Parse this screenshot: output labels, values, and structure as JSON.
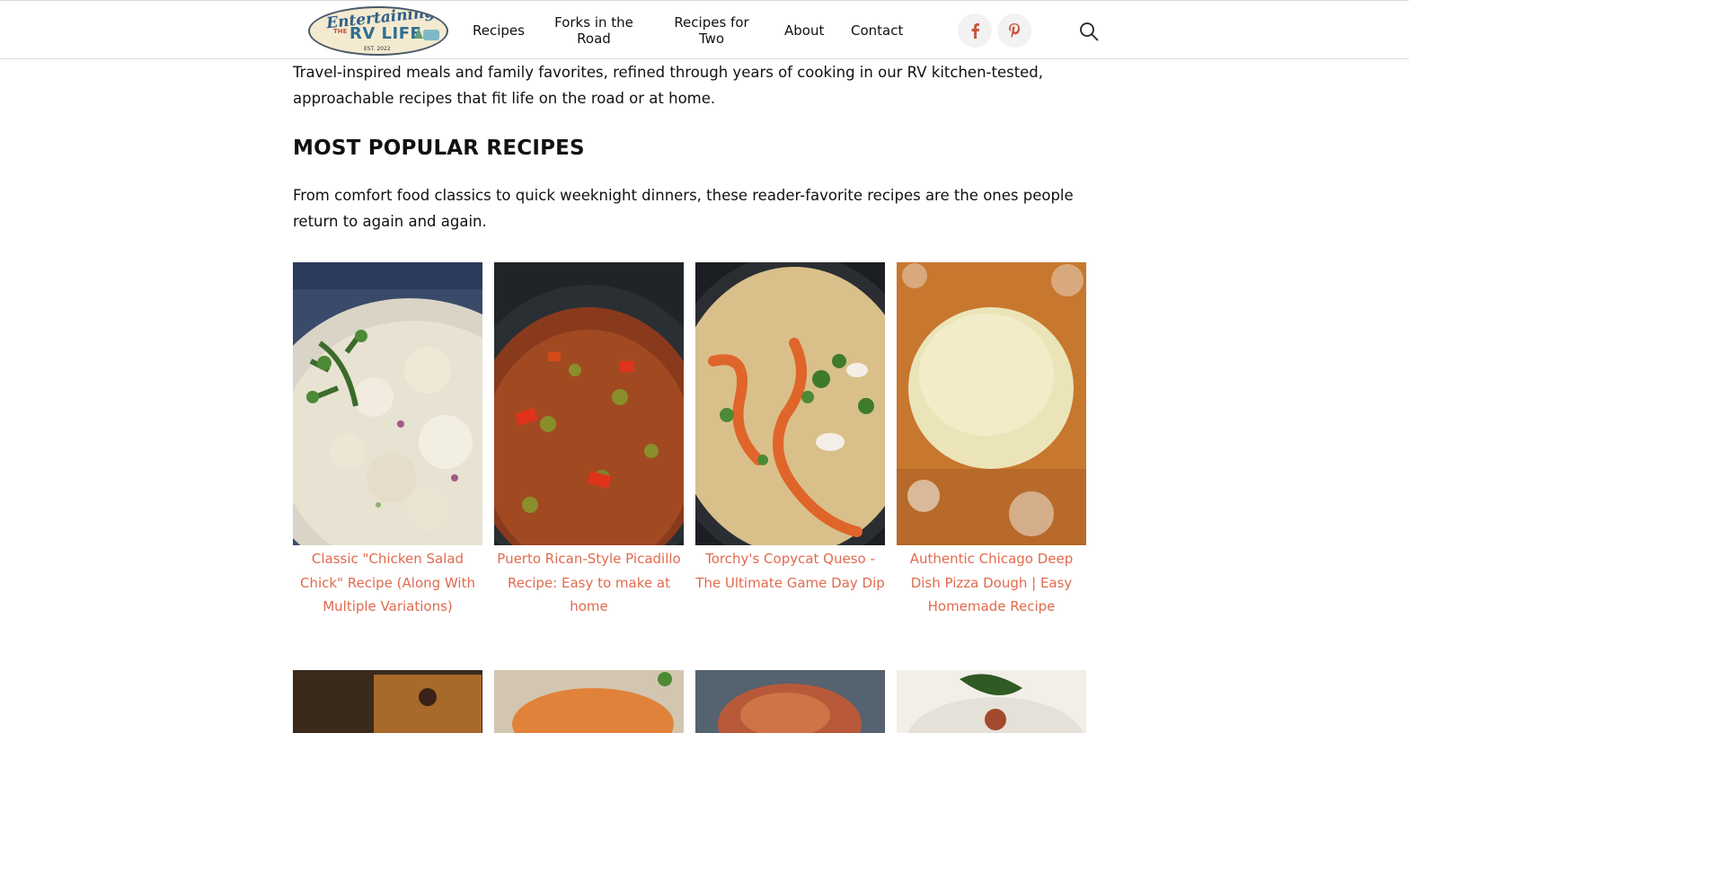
{
  "header": {
    "logo": {
      "line1": "Entertaining",
      "line2": "THE",
      "line3": "RV LIFE",
      "line4": "EST. 2022"
    },
    "nav": [
      "Recipes",
      "Forks in the Road",
      "Recipes for Two",
      "About",
      "Contact"
    ],
    "nav_lines": {
      "forks": [
        "Forks in the",
        "Road"
      ],
      "two": [
        "Recipes for",
        "Two"
      ]
    },
    "social": [
      "facebook-icon",
      "pinterest-icon"
    ],
    "search_icon": "search-icon"
  },
  "intro": "Travel-inspired meals and family favorites, refined through years of cooking in our RV kitchen-tested, approachable recipes that fit life on the road or at home.",
  "section": {
    "title": "MOST POPULAR RECIPES",
    "description": "From comfort food classics to quick weeknight dinners, these reader-favorite recipes are the ones people return to again and again."
  },
  "recipes": [
    {
      "title": "Classic \"Chicken Salad Chick\" Recipe (Along With Multiple Variations)"
    },
    {
      "title": "Puerto Rican-Style Picadillo Recipe: Easy to make at home"
    },
    {
      "title": "Torchy's Copycat Queso - The Ultimate Game Day Dip"
    },
    {
      "title": "Authentic Chicago Deep Dish Pizza Dough | Easy Homemade Recipe"
    }
  ],
  "colors": {
    "accent": "#e06a4e",
    "text": "#111111",
    "border": "#d9d9d9"
  }
}
